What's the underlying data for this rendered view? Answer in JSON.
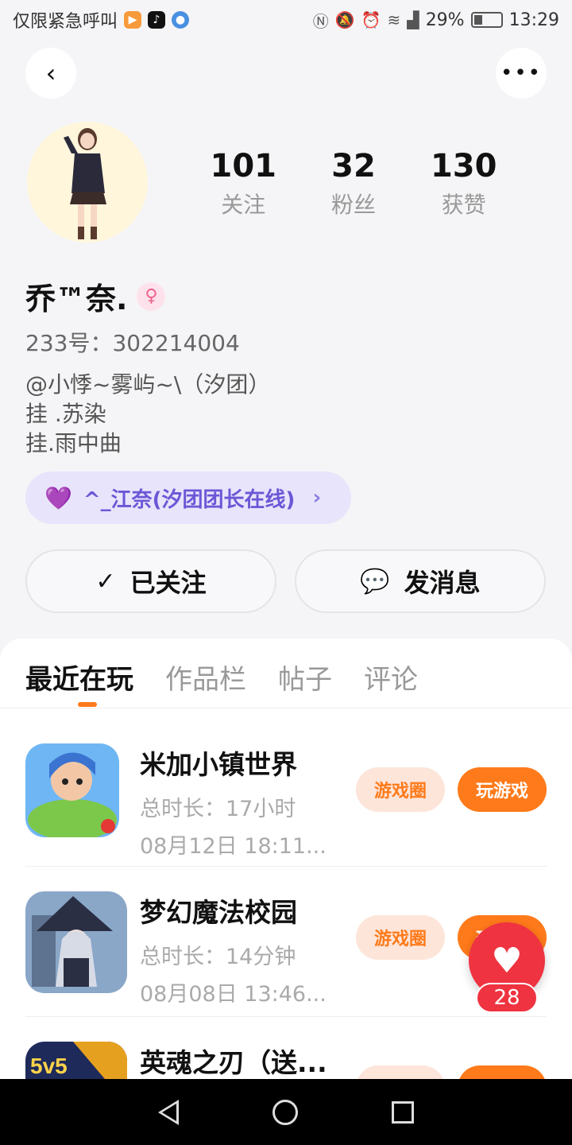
{
  "status_bar": {
    "carrier": "仅限紧急呼叫",
    "battery": "29%",
    "time": "13:29",
    "apps": [
      "play-icon",
      "tiktok-icon",
      "browser-icon"
    ],
    "system_icons": [
      "nfc-icon",
      "mute-icon",
      "alarm-icon",
      "wifi-icon",
      "signal-icon"
    ]
  },
  "profile": {
    "name": "乔™奈.",
    "gender_symbol": "♀",
    "id_line": "233号：302214004",
    "bio_lines": [
      "@小悸~雾屿~\\（汐团）",
      "挂 .苏染",
      "挂.雨中曲"
    ],
    "team_chip": "^_江奈(汐团团长在线)",
    "stats": [
      {
        "value": "101",
        "label": "关注"
      },
      {
        "value": "32",
        "label": "粉丝"
      },
      {
        "value": "130",
        "label": "获赞"
      }
    ]
  },
  "actions": {
    "follow_label": "已关注",
    "message_label": "发消息"
  },
  "tabs": [
    {
      "label": "最近在玩",
      "active": true
    },
    {
      "label": "作品栏",
      "active": false
    },
    {
      "label": "帖子",
      "active": false
    },
    {
      "label": "评论",
      "active": false
    }
  ],
  "games": [
    {
      "title": "米加小镇世界",
      "duration": "总时长：17小时",
      "last_played": "08月12日 18:11...",
      "circle_label": "游戏圈",
      "play_label": "玩游戏"
    },
    {
      "title": "梦幻魔法校园",
      "duration": "总时长：14分钟",
      "last_played": "08月08日 13:46...",
      "circle_label": "游戏圈",
      "play_label": "玩游戏"
    },
    {
      "title": "英魂之刃（送...",
      "duration": "",
      "last_played": "",
      "circle_label": "游戏圈",
      "play_label": "玩游戏"
    }
  ],
  "like_fab": {
    "count": "28"
  },
  "colors": {
    "accent": "#ff7a1a",
    "team_purple": "#6b57d6",
    "like_red": "#ef3340"
  }
}
